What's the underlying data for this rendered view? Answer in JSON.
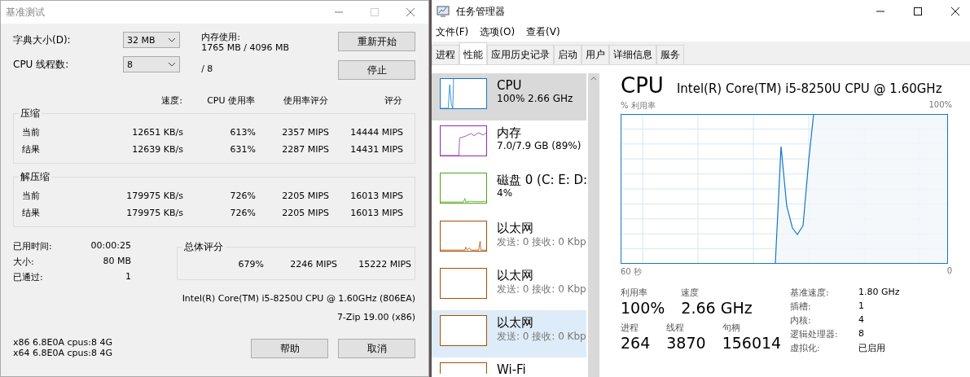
{
  "benchmark_window": {
    "title": "基准测试",
    "settings": [
      {
        "label": "字典大小(D):",
        "value": "32 MB"
      },
      {
        "label": "CPU 线程数:",
        "value": "8"
      }
    ],
    "memory_usage": {
      "label": "内存使用:",
      "value": "1765 MB / 4096 MB"
    },
    "thread_total": "/ 8",
    "top_buttons": [
      "重新开始",
      "停止"
    ],
    "columns": [
      "速度:",
      "CPU 使用率",
      "使用率评分",
      "评分"
    ],
    "groups": [
      {
        "title": "压缩",
        "rows": [
          {
            "label": "当前",
            "values": [
              "12651 KB/s",
              "613%",
              "2357 MIPS",
              "14444 MIPS"
            ]
          },
          {
            "label": "结果",
            "values": [
              "12639 KB/s",
              "631%",
              "2287 MIPS",
              "14431 MIPS"
            ]
          }
        ]
      },
      {
        "title": "解压缩",
        "rows": [
          {
            "label": "当前",
            "values": [
              "179975 KB/s",
              "726%",
              "2205 MIPS",
              "16013 MIPS"
            ]
          },
          {
            "label": "结果",
            "values": [
              "179975 KB/s",
              "726%",
              "2205 MIPS",
              "16013 MIPS"
            ]
          }
        ]
      }
    ],
    "stats": [
      {
        "label": "已用时间:",
        "value": "00:00:25"
      },
      {
        "label": "大小:",
        "value": "80 MB"
      },
      {
        "label": "已通过:",
        "value": "1"
      }
    ],
    "overall": {
      "title": "总体评分",
      "values": [
        "679%",
        "2246 MIPS",
        "15222 MIPS"
      ]
    },
    "cpu_info": "Intel(R) Core(TM) i5-8250U CPU @ 1.60GHz (806EA)",
    "version": "7-Zip 19.00 (x86)",
    "cpu_flags": [
      "x86 6.8E0A cpus:8 4G",
      "x64 6.8E0A cpus:8 4G"
    ],
    "bottom_buttons": [
      "帮助",
      "取消"
    ]
  },
  "task_manager": {
    "title": "任务管理器",
    "menu": [
      "文件(F)",
      "选项(O)",
      "查看(V)"
    ],
    "tabs": [
      {
        "label": "进程",
        "selected": false
      },
      {
        "label": "性能",
        "selected": true
      },
      {
        "label": "应用历史记录",
        "selected": false
      },
      {
        "label": "启动",
        "selected": false
      },
      {
        "label": "用户",
        "selected": false
      },
      {
        "label": "详细信息",
        "selected": false
      },
      {
        "label": "服务",
        "selected": false
      }
    ],
    "devices": [
      {
        "kind": "cpu",
        "name": "CPU",
        "detail": "100% 2.66 GHz",
        "color": "#1178c8",
        "selected": true,
        "hovered": false
      },
      {
        "kind": "memory",
        "name": "内存",
        "detail": "7.0/7.9 GB (89%)",
        "color": "#9528b4",
        "selected": false,
        "hovered": false
      },
      {
        "kind": "disk",
        "name": "磁盘 0 (C: E: D:",
        "detail": "4%",
        "color": "#4da60c",
        "selected": false,
        "hovered": false
      },
      {
        "kind": "network",
        "name": "以太网",
        "detail": "发送: 0 接收: 0 Kbp",
        "color": "#a74f01",
        "selected": false,
        "hovered": false
      },
      {
        "kind": "network-idle",
        "name": "以太网",
        "detail": "发送: 0 接收: 0 Kbp",
        "color": "#a74f01",
        "selected": false,
        "hovered": false
      },
      {
        "kind": "network-idle",
        "name": "以太网",
        "detail": "发送: 0 接收: 0 Kbp",
        "color": "#a74f01",
        "selected": false,
        "hovered": true
      },
      {
        "kind": "wifi",
        "name": "Wi-Fi",
        "color": "#a74f01",
        "selected": false,
        "hovered": false
      }
    ],
    "header": {
      "title": "CPU",
      "model": "Intel(R) Core(TM) i5-8250U CPU @ 1.60GHz"
    },
    "chart": {
      "ylabel": "% 利用率",
      "ymax_label": "100%",
      "xmin_label": "60 秒",
      "xmax_label": "0"
    },
    "big_stats": [
      [
        {
          "label": "利用率",
          "value": "100%"
        },
        {
          "label": "速度",
          "value": "2.66 GHz"
        }
      ],
      [
        {
          "label": "进程",
          "value": "264"
        },
        {
          "label": "线程",
          "value": "3870"
        },
        {
          "label": "句柄",
          "value": "156014"
        }
      ]
    ],
    "specs": [
      {
        "label": "基准速度:",
        "value": "1.80 GHz"
      },
      {
        "label": "插槽:",
        "value": "1"
      },
      {
        "label": "内核:",
        "value": "4"
      },
      {
        "label": "逻辑处理器:",
        "value": "8"
      },
      {
        "label": "虚拟化:",
        "value": "已启用"
      }
    ]
  }
}
